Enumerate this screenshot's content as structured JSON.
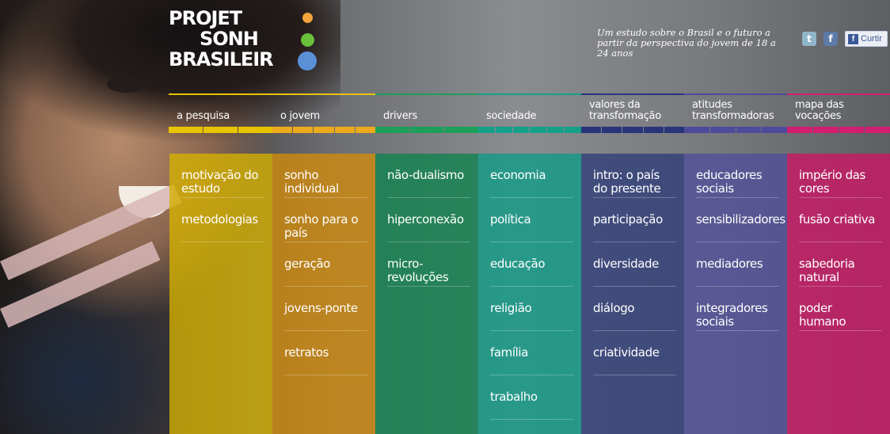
{
  "logo": {
    "line1": "PROJET",
    "line2": "SONH",
    "line3": "BRASILEIR"
  },
  "colors": {
    "yellow": "#e8c400",
    "orange": "#ecaa1c",
    "green": "#1d9e5a",
    "teal": "#16a08a",
    "navy": "#28357a",
    "violet": "#4e4b9c",
    "pink": "#d21e6e",
    "logo_dot_orange": "#f2a33a",
    "logo_dot_green": "#6bbf3a",
    "logo_dot_blue": "#5b8fd6"
  },
  "tagline": "Um estudo sobre o Brasil e o futuro a partir da perspectiva do jovem de 18 a 24 anos",
  "social": {
    "twitter": "twitter-icon",
    "facebook": "facebook-icon",
    "curtir_label": "Curtir"
  },
  "nav": [
    {
      "label": "a pesquisa"
    },
    {
      "label": "o jovem"
    },
    {
      "label": "drivers"
    },
    {
      "label": "sociedade"
    },
    {
      "label": "valores da transformação"
    },
    {
      "label": "atitudes transformadoras"
    },
    {
      "label": "mapa das vocações"
    }
  ],
  "columns": [
    {
      "items": [
        "motivação do estudo",
        "metodologias"
      ]
    },
    {
      "items": [
        "sonho individual",
        "sonho para o país",
        "geração",
        "jovens-ponte",
        "retratos"
      ]
    },
    {
      "items": [
        "não-dualismo",
        "hiperconexão",
        "micro-revoluções"
      ]
    },
    {
      "items": [
        "economia",
        "política",
        "educação",
        "religião",
        "família",
        "trabalho"
      ]
    },
    {
      "items": [
        "intro: o país do presente",
        "participação",
        "diversidade",
        "diálogo",
        "criatividade"
      ]
    },
    {
      "items": [
        "educadores sociais",
        "sensibilizadores",
        "mediadores",
        "integradores sociais"
      ]
    },
    {
      "items": [
        "império das cores",
        "fusão criativa",
        "sabedoria natural",
        "poder humano"
      ]
    }
  ]
}
